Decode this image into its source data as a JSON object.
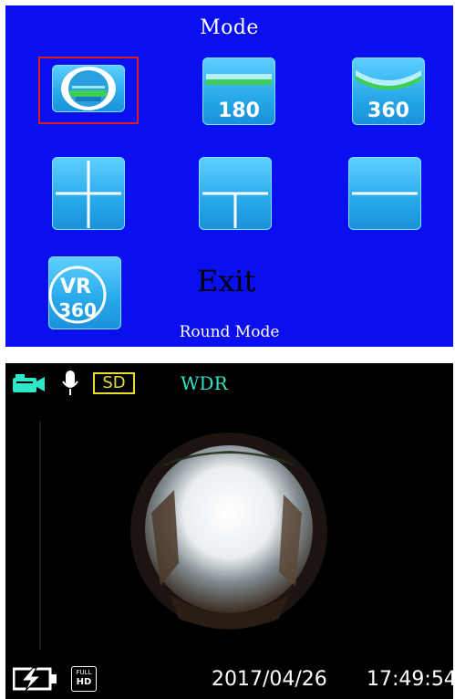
{
  "mode_menu": {
    "title": "Mode",
    "options": [
      {
        "icon": "round-mode-icon",
        "label": "",
        "selected": true
      },
      {
        "icon": "panorama-180-icon",
        "label": "180",
        "selected": false
      },
      {
        "icon": "panorama-360-icon",
        "label": "360",
        "selected": false
      },
      {
        "icon": "quad-split-icon",
        "label": "",
        "selected": false
      },
      {
        "icon": "triple-split-icon",
        "label": "",
        "selected": false
      },
      {
        "icon": "dual-split-icon",
        "label": "",
        "selected": false
      },
      {
        "icon": "vr-360-icon",
        "label": "VR\n360",
        "selected": false
      }
    ],
    "vr_text_1": "VR",
    "vr_text_2": "360",
    "exit_label": "Exit",
    "current_mode": "Round Mode",
    "colors": {
      "background": "#0a0ff0",
      "tile": "#27a8ea",
      "selection": "#d02020"
    }
  },
  "camera_view": {
    "status": {
      "camera_icon": "video-camera-icon",
      "mic_icon": "microphone-icon",
      "storage_badge": "SD",
      "wdr_label": "WDR"
    },
    "footer": {
      "battery_icon": "battery-charging-icon",
      "resolution_line1": "FULL",
      "resolution_line2": "HD",
      "date": "2017/04/26",
      "time": "17:49:54"
    },
    "colors": {
      "camera_icon": "#2ee6c8",
      "storage_badge": "#e5dc2e",
      "wdr": "#2ee6c8"
    }
  }
}
